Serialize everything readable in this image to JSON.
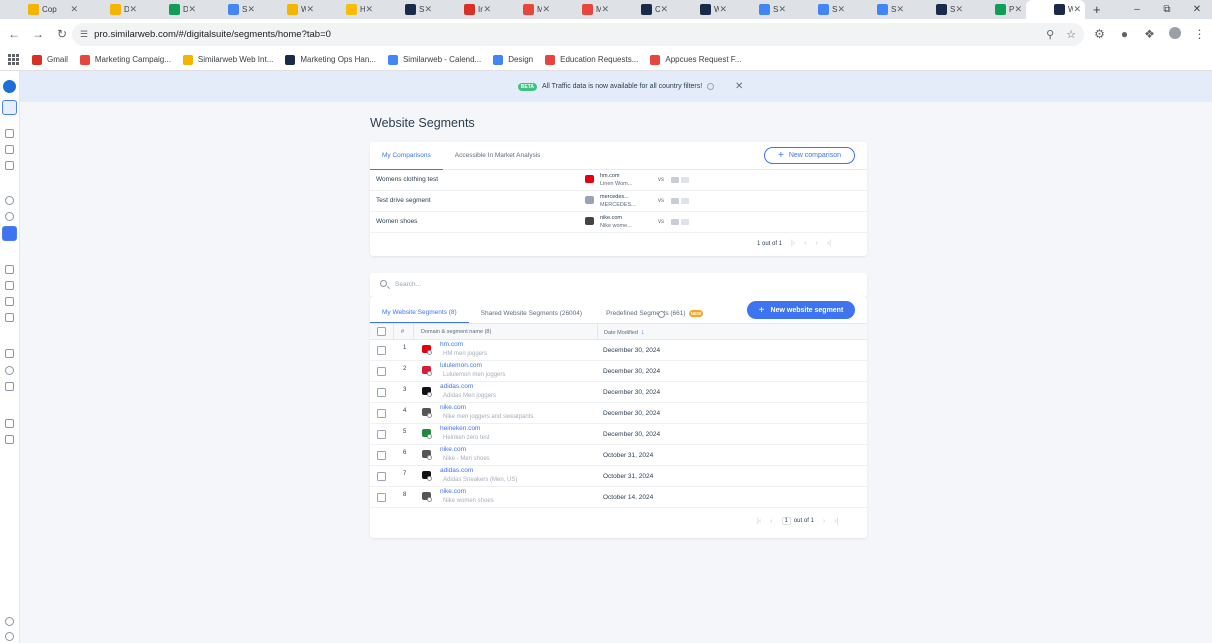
{
  "browser": {
    "tabs": [
      {
        "title": "Cop",
        "color": "#f4b400"
      },
      {
        "title": "Der",
        "color": "#f4b400"
      },
      {
        "title": "Der",
        "color": "#0f9d58"
      },
      {
        "title": "Sim",
        "color": "#4285f4"
      },
      {
        "title": "Wel",
        "color": "#f4b400"
      },
      {
        "title": "Hov",
        "color": "#fbbc04"
      },
      {
        "title": "Sim",
        "color": "#1a2b49"
      },
      {
        "title": "Inb",
        "color": "#d93025"
      },
      {
        "title": "Ma",
        "color": "#e8453c"
      },
      {
        "title": "My",
        "color": "#e8453c"
      },
      {
        "title": "Cor",
        "color": "#1a2b49"
      },
      {
        "title": "Wel",
        "color": "#1a2b49"
      },
      {
        "title": "Sea",
        "color": "#4285f4"
      },
      {
        "title": "Sea",
        "color": "#4285f4"
      },
      {
        "title": "Sea",
        "color": "#4285f4"
      },
      {
        "title": "Sea",
        "color": "#1a2b49"
      },
      {
        "title": "Pro",
        "color": "#0f9d58"
      },
      {
        "title": "Wel",
        "color": "#1a2b49"
      }
    ],
    "url": "pro.similarweb.com/#/digitalsuite/segments/home?tab=0",
    "bookmarks": [
      {
        "label": "Gmail",
        "color": "#d93025"
      },
      {
        "label": "Marketing Campaig...",
        "color": "#e8453c"
      },
      {
        "label": "Similarweb Web Int...",
        "color": "#f4b400"
      },
      {
        "label": "Marketing Ops Han...",
        "color": "#1a2b49"
      },
      {
        "label": "Similarweb - Calend...",
        "color": "#4285f4"
      },
      {
        "label": "Design",
        "color": "#4285f4"
      },
      {
        "label": "Education Requests...",
        "color": "#e8453c"
      },
      {
        "label": "Appcues Request F...",
        "color": "#e8453c"
      }
    ]
  },
  "banner": {
    "badge": "BETA",
    "text": "All Traffic data is now available for all country filters!"
  },
  "page_title": "Website Segments",
  "comparisons": {
    "tabs": [
      "My Comparisons",
      "Accessible In Market Analysis"
    ],
    "new_button": "New comparison",
    "rows": [
      {
        "name": "Womens clothing test",
        "site": "hm.com",
        "desc": "Linen Wom...",
        "vs": "vs",
        "color": "#e50010"
      },
      {
        "name": "Test drive segment",
        "site": "mercedes...",
        "desc": "MERCEDES...",
        "vs": "vs",
        "color": "#9aa4b2"
      },
      {
        "name": "Women shoes",
        "site": "nike.com",
        "desc": "Nike wome...",
        "vs": "vs",
        "color": "#444444"
      }
    ],
    "pager": "1 out of 1"
  },
  "search": {
    "placeholder": "Search..."
  },
  "segments": {
    "tabs": [
      {
        "label": "My Website Segments (8)"
      },
      {
        "label": "Shared Website Segments (26004)"
      },
      {
        "label": "Predefined Segments (661)",
        "badge": "NEW"
      }
    ],
    "new_button": "New website segment",
    "columns": [
      "#",
      "Domain & segment name (8)",
      "Date Modified"
    ],
    "rows": [
      {
        "n": "1",
        "domain": "hm.com",
        "segment": "HM men joggers",
        "date": "December 30, 2024",
        "color": "#e50010"
      },
      {
        "n": "2",
        "domain": "lululemon.com",
        "segment": "Lululemon men joggers",
        "date": "December 30, 2024",
        "color": "#d31f36"
      },
      {
        "n": "3",
        "domain": "adidas.com",
        "segment": "Adidas Men joggers",
        "date": "December 30, 2024",
        "color": "#111111"
      },
      {
        "n": "4",
        "domain": "nike.com",
        "segment": "Nike men joggers and sweatpants",
        "date": "December 30, 2024",
        "color": "#555555"
      },
      {
        "n": "5",
        "domain": "heineken.com",
        "segment": "Heinken zero test",
        "date": "December 30, 2024",
        "color": "#1f8a3b"
      },
      {
        "n": "6",
        "domain": "nike.com",
        "segment": "Nike - Men shoes",
        "date": "October 31, 2024",
        "color": "#555555"
      },
      {
        "n": "7",
        "domain": "adidas.com",
        "segment": "Adidas Sneakers (Men, US)",
        "date": "October 31, 2024",
        "color": "#111111"
      },
      {
        "n": "8",
        "domain": "nike.com",
        "segment": "Nike women shoes",
        "date": "October 14, 2024",
        "color": "#555555"
      }
    ],
    "pager_page": "1",
    "pager_total": "out of 1"
  }
}
